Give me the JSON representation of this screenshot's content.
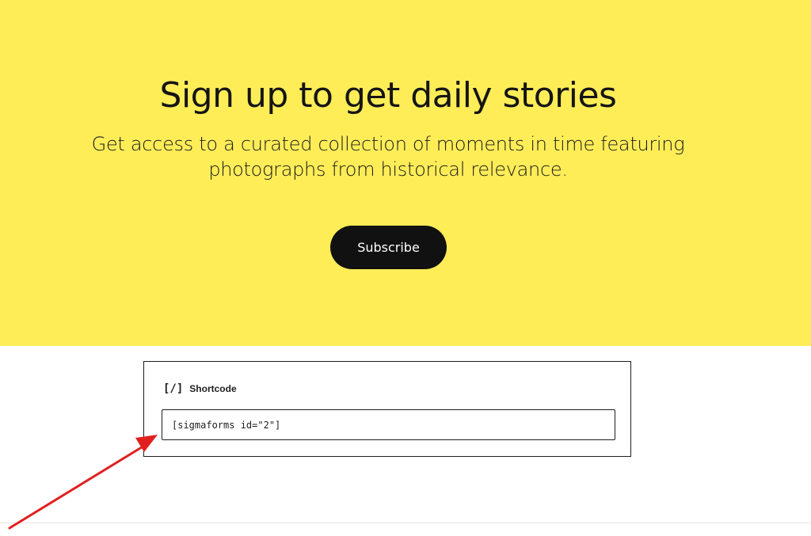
{
  "hero": {
    "title": "Sign up to get daily stories",
    "subtitle_line1": "Get access to a curated collection of moments in time featuring",
    "subtitle_line2": "photographs from historical relevance.",
    "subscribe_label": "Subscribe",
    "background_color": "#ffed58"
  },
  "shortcode_block": {
    "icon": "[/]",
    "label": "Shortcode",
    "value": "[sigmaforms id=\"2\"]"
  },
  "annotation": {
    "arrow_color": "#e02020",
    "icon_name": "red-arrow-annotation"
  }
}
